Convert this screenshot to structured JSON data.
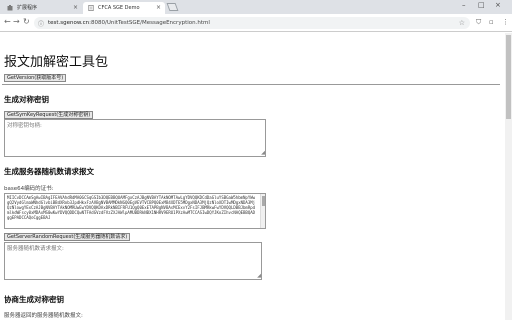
{
  "tabs": [
    {
      "label": "扩展程序",
      "active": false
    },
    {
      "label": "CFCA SGE Demo",
      "active": true
    }
  ],
  "address": {
    "host": "test.sgenow.cn",
    "path": ":8080/UnitTestSGE/MessageEncryption.html"
  },
  "page": {
    "title": "报文加解密工具包",
    "get_version_btn": "GetVersion(获取版本号)",
    "sec1_title": "生成对称密钥",
    "sec1_btn": "GetSymKeyRequest(生成对称密钥)",
    "sec1_placeholder": "对称密钥句柄:",
    "sec2_title": "生成服务器随机数请求报文",
    "sec2_label": "base64编码的证书:",
    "sec2_cert": "MIICvDCCAmSgAwIBAgIFEAVAhdRdMA0GCSqGSIb3DQEBBQUAMFgxCzAJBgNVBAYTAkNOMTAwLgYDVQQKDCdDaGluYSBGaW5hbmNpYWwgQ2VydGlmaWNhdGlvbiBBdXRob3JpdHkxFzAVBgNVBAMMDkNGQ0EgVEVTVCBPQ0ExMB4XDTE5MDgxNDA3MjQzNloXDTIwMDgxNDA3MjQzNlowgYExCzAJBgNVBAYTAkNOMRUwEwYDVQQKDAxDRkNBIFRFU1QgQ0ExETAPBgNVBAsMCExvY2FsIFJBMRkwFwYDVQQLDBBJbmRpdmlkdWFscy0xMDAxMS0wKwYDVQQDDCQwNTFAdGVzdFVzZXJAWlpAMUBDRkNBX1NHRV9ERU1PXzAwMTCCASIwDQYJKoZIhvcNAQEBBQADggEPADCCAQoCggEBAJ",
    "sec2_btn": "GetServerRandomRequest(生成服务器随机数请求)",
    "sec2_placeholder": "服务器随机数请求报文:",
    "sec3_title": "协商生成对称密钥",
    "sec3_label": "服务器返回的服务器随机数报文:"
  }
}
